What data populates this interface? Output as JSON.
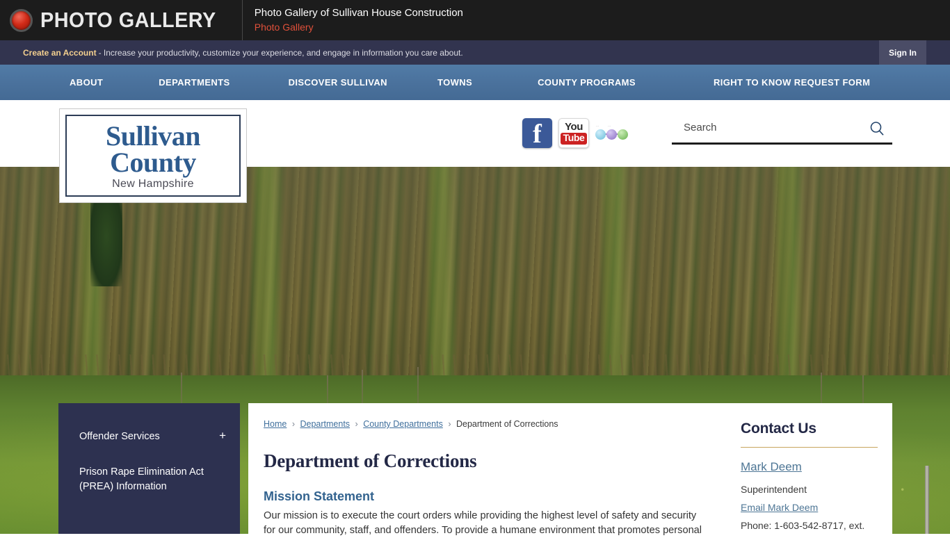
{
  "photo_gallery_bar": {
    "badge_label": "PHOTO GALLERY",
    "badge_icon": "red-circle-icon",
    "meta_main": "Photo Gallery of Sullivan House Construction",
    "meta_sub": "Photo Gallery",
    "accent_red": "#e0503a",
    "background": "#1c1c1c"
  },
  "account_bar": {
    "link_label": "Create an Account",
    "message": "- Increase your productivity, customize your experience, and engage in information you care about.",
    "sign_in_label": "Sign In",
    "background": "#32344f",
    "link_color": "#f3cf8f"
  },
  "main_nav": {
    "background": "#4a719c",
    "items": [
      {
        "label": "ABOUT"
      },
      {
        "label": "DEPARTMENTS"
      },
      {
        "label": "DISCOVER SULLIVAN"
      },
      {
        "label": "TOWNS"
      },
      {
        "label": "COUNTY PROGRAMS"
      },
      {
        "label": "RIGHT TO KNOW REQUEST FORM"
      }
    ]
  },
  "logo": {
    "line1": "Sullivan",
    "line2": "County",
    "line3": "New Hampshire",
    "color": "#2e5b8e"
  },
  "social": {
    "facebook_icon": "facebook-icon",
    "youtube_icon_top": "You",
    "youtube_icon_bottom": "Tube",
    "share_icon": "share-network-icon",
    "share_label_1": "···",
    "share_label_2": "···"
  },
  "search": {
    "placeholder": "Search",
    "value": "",
    "icon": "search-icon"
  },
  "sidebar": {
    "items": [
      {
        "label": "Offender Services",
        "expander": "+",
        "has_children": true
      },
      {
        "label": "Prison Rape Elimination Act (PREA) Information",
        "expander": "",
        "has_children": false
      }
    ],
    "background": "#2d3150"
  },
  "breadcrumb": {
    "items": [
      {
        "label": "Home",
        "link": true
      },
      {
        "label": "Departments",
        "link": true
      },
      {
        "label": "County Departments",
        "link": true
      },
      {
        "label": "Department of Corrections",
        "link": false
      }
    ],
    "separator": "›"
  },
  "main": {
    "page_title": "Department of Corrections",
    "section_title": "Mission Statement",
    "body": "Our mission is to execute the court orders while providing the highest level of safety and security for our community, staff, and offenders. To provide a humane environment that promotes personal"
  },
  "contact": {
    "heading": "Contact Us",
    "rule_color": "#c8a55d",
    "name": "Mark Deem",
    "role": "Superintendent",
    "email_label": "Email Mark Deem",
    "phone": "Phone: 1-603-542-8717, ext."
  }
}
